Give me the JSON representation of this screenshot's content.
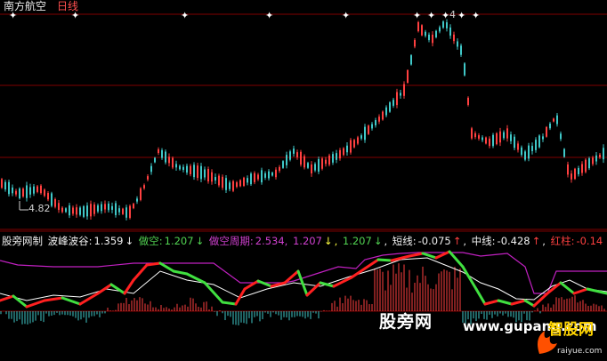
{
  "header": {
    "stock_name": "南方航空",
    "period": "日线"
  },
  "price_chart": {
    "low_label": "4.82",
    "peak_label": "4",
    "gridline_color": "#800000",
    "up_color": "#ff4040",
    "down_color": "#40c8c8"
  },
  "indicator": {
    "name": "股旁网制",
    "label_wave": "波峰波谷:",
    "value_wave": "1.359",
    "label_short": "做空:",
    "value_short": "1.207",
    "label_cycle": "做空周期:",
    "value_cycle": "2.534,",
    "value_cycle_b": "1.207",
    "value_cycle_c": "1.207",
    "label_short_line": "短线:",
    "value_short_line": "-0.075",
    "label_mid_line": "中线:",
    "value_mid_line": "-0.428",
    "label_red_bar": "红柱:",
    "value_red_bar": "-0.14",
    "arrow_down": "↓",
    "arrow_up": "↑"
  },
  "watermark": {
    "text": "股旁网",
    "url": "www.gupang.com",
    "brand": "智股网",
    "brand_sub": "raiyue.com"
  }
}
